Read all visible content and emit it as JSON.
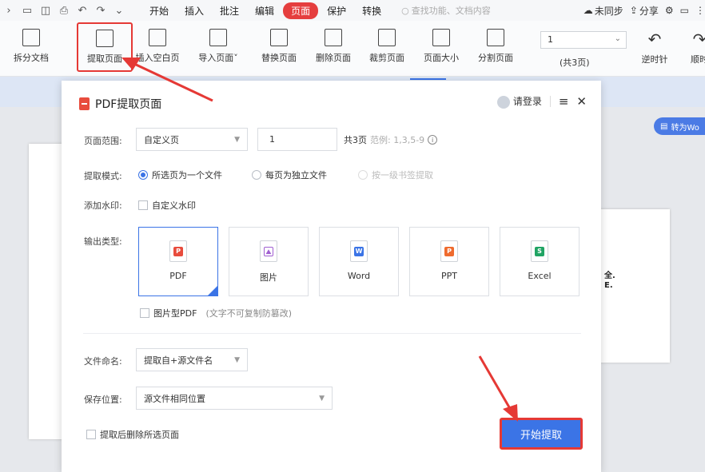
{
  "menubar": {
    "menus": [
      "开始",
      "插入",
      "批注",
      "编辑",
      "页面",
      "保护",
      "转换"
    ],
    "active_menu": "页面",
    "search_placeholder": "查找功能、文档内容",
    "sync": "未同步",
    "share": "分享"
  },
  "ribbon": {
    "buttons": [
      "拆分文档",
      "提取页面",
      "插入空白页",
      "导入页面",
      "替换页面",
      "删除页面",
      "裁剪页面",
      "页面大小",
      "分割页面"
    ],
    "page_value": "1",
    "page_count": "(共3页)",
    "rotate_ccw": "逆时针",
    "rotate_cw": "顺时"
  },
  "convert_pill": "转为Wo",
  "dialog": {
    "title": "PDF提取页面",
    "login": "请登录",
    "page_range_label": "页面范围:",
    "page_range_value": "自定义页",
    "page_input": "1",
    "total_pages": "共3页",
    "example": "范例: 1,3,5-9",
    "mode_label": "提取模式:",
    "mode_options": [
      "所选页为一个文件",
      "每页为独立文件",
      "按一级书签提取"
    ],
    "watermark_label": "添加水印:",
    "watermark_option": "自定义水印",
    "output_label": "输出类型:",
    "output_types": [
      "PDF",
      "图片",
      "Word",
      "PPT",
      "Excel"
    ],
    "image_pdf": "图片型PDF",
    "image_pdf_note": "(文字不可复制防篡改)",
    "naming_label": "文件命名:",
    "naming_value": "提取自+源文件名",
    "save_label": "保存位置:",
    "save_value": "源文件相同位置",
    "delete_after": "提取后删除所选页面",
    "start_button": "开始提取"
  },
  "background_doc_text": [
    "全.",
    "E."
  ],
  "colors": {
    "accent": "#3b74e6",
    "highlight": "#e53935",
    "active_menu": "#e53e3e"
  }
}
